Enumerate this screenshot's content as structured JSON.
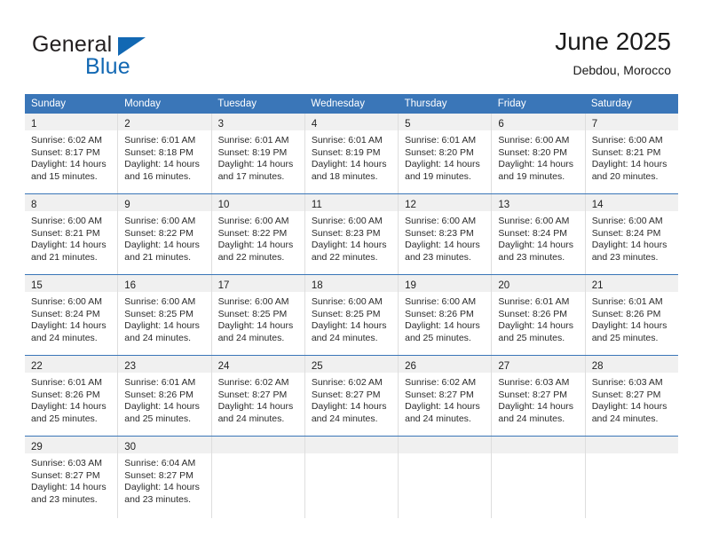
{
  "brand": {
    "word_one": "General",
    "word_two": "Blue",
    "triangle_color": "#1268b3",
    "text_color": "#231f20"
  },
  "header": {
    "title": "June 2025",
    "subtitle": "Debdou, Morocco"
  },
  "theme": {
    "header_blue": "#3a76b8",
    "daynum_band": "#f0f0f0",
    "grid_line": "#dedede",
    "text": "#2b2b2b"
  },
  "weekday_headers": [
    "Sunday",
    "Monday",
    "Tuesday",
    "Wednesday",
    "Thursday",
    "Friday",
    "Saturday"
  ],
  "labels": {
    "sunrise_prefix": "Sunrise:",
    "sunset_prefix": "Sunset:",
    "daylight_prefix": "Daylight:"
  },
  "weeks": [
    [
      {
        "day": "1",
        "sunrise": "Sunrise: 6:02 AM",
        "sunset": "Sunset: 8:17 PM",
        "daylight_1": "Daylight: 14 hours",
        "daylight_2": "and 15 minutes."
      },
      {
        "day": "2",
        "sunrise": "Sunrise: 6:01 AM",
        "sunset": "Sunset: 8:18 PM",
        "daylight_1": "Daylight: 14 hours",
        "daylight_2": "and 16 minutes."
      },
      {
        "day": "3",
        "sunrise": "Sunrise: 6:01 AM",
        "sunset": "Sunset: 8:19 PM",
        "daylight_1": "Daylight: 14 hours",
        "daylight_2": "and 17 minutes."
      },
      {
        "day": "4",
        "sunrise": "Sunrise: 6:01 AM",
        "sunset": "Sunset: 8:19 PM",
        "daylight_1": "Daylight: 14 hours",
        "daylight_2": "and 18 minutes."
      },
      {
        "day": "5",
        "sunrise": "Sunrise: 6:01 AM",
        "sunset": "Sunset: 8:20 PM",
        "daylight_1": "Daylight: 14 hours",
        "daylight_2": "and 19 minutes."
      },
      {
        "day": "6",
        "sunrise": "Sunrise: 6:00 AM",
        "sunset": "Sunset: 8:20 PM",
        "daylight_1": "Daylight: 14 hours",
        "daylight_2": "and 19 minutes."
      },
      {
        "day": "7",
        "sunrise": "Sunrise: 6:00 AM",
        "sunset": "Sunset: 8:21 PM",
        "daylight_1": "Daylight: 14 hours",
        "daylight_2": "and 20 minutes."
      }
    ],
    [
      {
        "day": "8",
        "sunrise": "Sunrise: 6:00 AM",
        "sunset": "Sunset: 8:21 PM",
        "daylight_1": "Daylight: 14 hours",
        "daylight_2": "and 21 minutes."
      },
      {
        "day": "9",
        "sunrise": "Sunrise: 6:00 AM",
        "sunset": "Sunset: 8:22 PM",
        "daylight_1": "Daylight: 14 hours",
        "daylight_2": "and 21 minutes."
      },
      {
        "day": "10",
        "sunrise": "Sunrise: 6:00 AM",
        "sunset": "Sunset: 8:22 PM",
        "daylight_1": "Daylight: 14 hours",
        "daylight_2": "and 22 minutes."
      },
      {
        "day": "11",
        "sunrise": "Sunrise: 6:00 AM",
        "sunset": "Sunset: 8:23 PM",
        "daylight_1": "Daylight: 14 hours",
        "daylight_2": "and 22 minutes."
      },
      {
        "day": "12",
        "sunrise": "Sunrise: 6:00 AM",
        "sunset": "Sunset: 8:23 PM",
        "daylight_1": "Daylight: 14 hours",
        "daylight_2": "and 23 minutes."
      },
      {
        "day": "13",
        "sunrise": "Sunrise: 6:00 AM",
        "sunset": "Sunset: 8:24 PM",
        "daylight_1": "Daylight: 14 hours",
        "daylight_2": "and 23 minutes."
      },
      {
        "day": "14",
        "sunrise": "Sunrise: 6:00 AM",
        "sunset": "Sunset: 8:24 PM",
        "daylight_1": "Daylight: 14 hours",
        "daylight_2": "and 23 minutes."
      }
    ],
    [
      {
        "day": "15",
        "sunrise": "Sunrise: 6:00 AM",
        "sunset": "Sunset: 8:24 PM",
        "daylight_1": "Daylight: 14 hours",
        "daylight_2": "and 24 minutes."
      },
      {
        "day": "16",
        "sunrise": "Sunrise: 6:00 AM",
        "sunset": "Sunset: 8:25 PM",
        "daylight_1": "Daylight: 14 hours",
        "daylight_2": "and 24 minutes."
      },
      {
        "day": "17",
        "sunrise": "Sunrise: 6:00 AM",
        "sunset": "Sunset: 8:25 PM",
        "daylight_1": "Daylight: 14 hours",
        "daylight_2": "and 24 minutes."
      },
      {
        "day": "18",
        "sunrise": "Sunrise: 6:00 AM",
        "sunset": "Sunset: 8:25 PM",
        "daylight_1": "Daylight: 14 hours",
        "daylight_2": "and 24 minutes."
      },
      {
        "day": "19",
        "sunrise": "Sunrise: 6:00 AM",
        "sunset": "Sunset: 8:26 PM",
        "daylight_1": "Daylight: 14 hours",
        "daylight_2": "and 25 minutes."
      },
      {
        "day": "20",
        "sunrise": "Sunrise: 6:01 AM",
        "sunset": "Sunset: 8:26 PM",
        "daylight_1": "Daylight: 14 hours",
        "daylight_2": "and 25 minutes."
      },
      {
        "day": "21",
        "sunrise": "Sunrise: 6:01 AM",
        "sunset": "Sunset: 8:26 PM",
        "daylight_1": "Daylight: 14 hours",
        "daylight_2": "and 25 minutes."
      }
    ],
    [
      {
        "day": "22",
        "sunrise": "Sunrise: 6:01 AM",
        "sunset": "Sunset: 8:26 PM",
        "daylight_1": "Daylight: 14 hours",
        "daylight_2": "and 25 minutes."
      },
      {
        "day": "23",
        "sunrise": "Sunrise: 6:01 AM",
        "sunset": "Sunset: 8:26 PM",
        "daylight_1": "Daylight: 14 hours",
        "daylight_2": "and 25 minutes."
      },
      {
        "day": "24",
        "sunrise": "Sunrise: 6:02 AM",
        "sunset": "Sunset: 8:27 PM",
        "daylight_1": "Daylight: 14 hours",
        "daylight_2": "and 24 minutes."
      },
      {
        "day": "25",
        "sunrise": "Sunrise: 6:02 AM",
        "sunset": "Sunset: 8:27 PM",
        "daylight_1": "Daylight: 14 hours",
        "daylight_2": "and 24 minutes."
      },
      {
        "day": "26",
        "sunrise": "Sunrise: 6:02 AM",
        "sunset": "Sunset: 8:27 PM",
        "daylight_1": "Daylight: 14 hours",
        "daylight_2": "and 24 minutes."
      },
      {
        "day": "27",
        "sunrise": "Sunrise: 6:03 AM",
        "sunset": "Sunset: 8:27 PM",
        "daylight_1": "Daylight: 14 hours",
        "daylight_2": "and 24 minutes."
      },
      {
        "day": "28",
        "sunrise": "Sunrise: 6:03 AM",
        "sunset": "Sunset: 8:27 PM",
        "daylight_1": "Daylight: 14 hours",
        "daylight_2": "and 24 minutes."
      }
    ],
    [
      {
        "day": "29",
        "sunrise": "Sunrise: 6:03 AM",
        "sunset": "Sunset: 8:27 PM",
        "daylight_1": "Daylight: 14 hours",
        "daylight_2": "and 23 minutes."
      },
      {
        "day": "30",
        "sunrise": "Sunrise: 6:04 AM",
        "sunset": "Sunset: 8:27 PM",
        "daylight_1": "Daylight: 14 hours",
        "daylight_2": "and 23 minutes."
      },
      {
        "day": "",
        "sunrise": "",
        "sunset": "",
        "daylight_1": "",
        "daylight_2": ""
      },
      {
        "day": "",
        "sunrise": "",
        "sunset": "",
        "daylight_1": "",
        "daylight_2": ""
      },
      {
        "day": "",
        "sunrise": "",
        "sunset": "",
        "daylight_1": "",
        "daylight_2": ""
      },
      {
        "day": "",
        "sunrise": "",
        "sunset": "",
        "daylight_1": "",
        "daylight_2": ""
      },
      {
        "day": "",
        "sunrise": "",
        "sunset": "",
        "daylight_1": "",
        "daylight_2": ""
      }
    ]
  ]
}
